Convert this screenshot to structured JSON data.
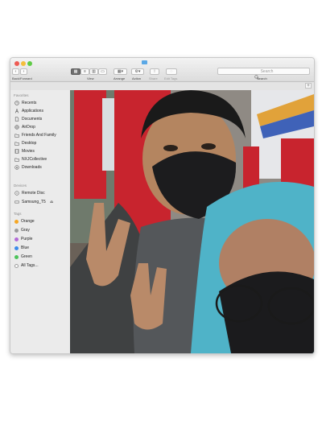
{
  "toolbar": {
    "back_forward_label": "Back/Forward",
    "view_label": "View",
    "arrange_label": "Arrange",
    "action_label": "Action",
    "share_label": "Share",
    "edit_tags_label": "Edit Tags",
    "search_placeholder": "Search",
    "search_label": "Search"
  },
  "sidebar": {
    "favorites_heading": "Favorites",
    "favorites": [
      {
        "label": "Recents",
        "icon": "clock-icon"
      },
      {
        "label": "Applications",
        "icon": "applications-icon"
      },
      {
        "label": "Documents",
        "icon": "document-icon"
      },
      {
        "label": "AirDrop",
        "icon": "airdrop-icon"
      },
      {
        "label": "Friends And Family",
        "icon": "folder-icon"
      },
      {
        "label": "Desktop",
        "icon": "folder-icon"
      },
      {
        "label": "Movies",
        "icon": "film-icon"
      },
      {
        "label": "NXJCollective",
        "icon": "folder-icon"
      },
      {
        "label": "Downloads",
        "icon": "download-icon"
      }
    ],
    "devices_heading": "Devices",
    "devices": [
      {
        "label": "Remote Disc",
        "icon": "disc-icon"
      },
      {
        "label": "Samsung_T5",
        "icon": "drive-icon",
        "eject": "⏏"
      }
    ],
    "tags_heading": "Tags",
    "tags": [
      {
        "label": "Orange",
        "color": "#f5a623"
      },
      {
        "label": "Gray",
        "color": "#9b9b9b"
      },
      {
        "label": "Purple",
        "color": "#b36ad8"
      },
      {
        "label": "Blue",
        "color": "#3b8beb"
      },
      {
        "label": "Green",
        "color": "#4cc35a"
      },
      {
        "label": "All Tags...",
        "color": "#d8d8d8"
      }
    ]
  },
  "colors": {
    "window_bg": "#ececec",
    "photo_wall_red": "#c8242e",
    "hoodie_teal": "#4fb3c8"
  }
}
